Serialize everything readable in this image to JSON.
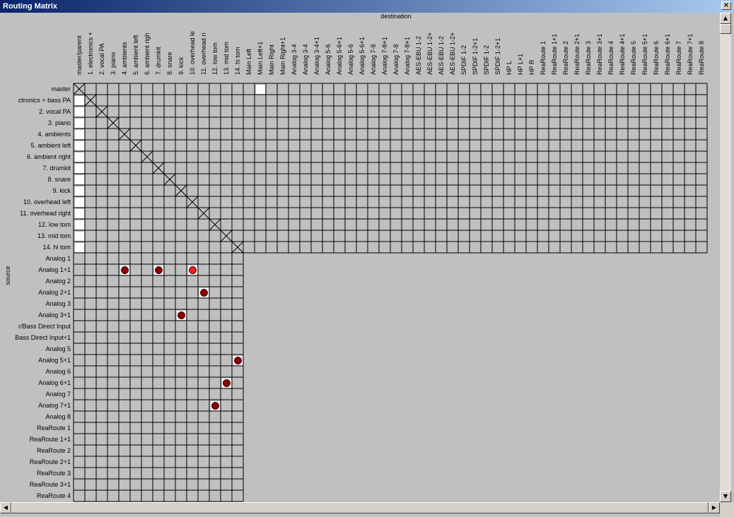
{
  "window": {
    "title": "Routing Matrix",
    "close_glyph": "×"
  },
  "axes": {
    "destination": "destination",
    "source": "source"
  },
  "columns": [
    "master/parent",
    "1. electronics +",
    "2. vocal PA",
    "3. piano",
    "4. ambients",
    "5. ambient left",
    "6. ambient righ",
    "7. drumkit",
    "8. snare",
    "9. kick",
    "10. overhead le",
    "11. overhead ri",
    "12. low tom",
    "13. mid tom",
    "14. hi tom",
    "Main Left",
    "Main Left+1",
    "Main Right",
    "Main Right+1",
    "Analog 3-4",
    "Analog 3-4",
    "Analog 3-4+1",
    "Analog 5-6",
    "Analog 5-6+1",
    "Analog 5-6",
    "Analog 5-6+1",
    "Analog 7-8",
    "Analog 7-8+1",
    "Analog 7-8",
    "Analog 7-8+1",
    "AES-EBU 1-2",
    "AES-EBU 1-2+",
    "AES-EBU 1-2",
    "AES-EBU 1-2+",
    "SPDIF 1-2",
    "SPDIF 1-2+1",
    "SPDIF 1-2",
    "SPDIF 1-2+1",
    "HP L",
    "HP L+1",
    "HP R",
    "ReaRoute 1",
    "ReaRoute 1+1",
    "ReaRoute 2",
    "ReaRoute 2+1",
    "ReaRoute 3",
    "ReaRoute 3+1",
    "ReaRoute 4",
    "ReaRoute 4+1",
    "ReaRoute 5",
    "ReaRoute 5+1",
    "ReaRoute 6",
    "ReaRoute 6+1",
    "ReaRoute 7",
    "ReaRoute 7+1",
    "ReaRoute 8"
  ],
  "rows": [
    "master",
    "ctronics + bass PA",
    "2. vocal PA",
    "3. piano",
    "4. ambients",
    "5. ambient left",
    "6. ambient right",
    "7. drumkit",
    "8. snare",
    "9. kick",
    "10. overhead left",
    "11. overhead right",
    "12. low tom",
    "13. mid tom",
    "14. hi tom",
    "Analog 1",
    "Analog 1+1",
    "Analog 2",
    "Analog 2+1",
    "Analog 3",
    "Analog 3+1",
    "r/Bass Direct Input",
    "Bass Direct Input+1",
    "Analog 5",
    "Analog 5+1",
    "Analog 6",
    "Analog 6+1",
    "Analog 7",
    "Analog 7+1",
    "Analog 8",
    "ReaRoute 1",
    "ReaRoute 1+1",
    "ReaRoute 2",
    "ReaRoute 2+1",
    "ReaRoute 3",
    "ReaRoute 3+1",
    "ReaRoute 4"
  ],
  "track_count": 15,
  "track_row_count": 15,
  "master_row_outputs": [
    1
  ],
  "connections": [
    {
      "source": "Analog 1+1",
      "destination": "4. ambients",
      "active": false
    },
    {
      "source": "Analog 1+1",
      "destination": "7. drumkit",
      "active": false
    },
    {
      "source": "Analog 1+1",
      "destination": "10. overhead le",
      "active": true
    },
    {
      "source": "Analog 2+1",
      "destination": "11. overhead ri",
      "active": false
    },
    {
      "source": "Analog 3+1",
      "destination": "9. kick",
      "active": false
    },
    {
      "source": "Analog 5+1",
      "destination": "14. hi tom",
      "active": false
    },
    {
      "source": "Analog 6+1",
      "destination": "13. mid tom",
      "active": false
    },
    {
      "source": "Analog 7+1",
      "destination": "12. low tom",
      "active": false
    }
  ],
  "colors": {
    "background": "#c0c0c0",
    "cell_line": "#000000",
    "connection_dot": "#8b0000",
    "connection_dot_active": "#ff1a1a",
    "cell_white": "#ffffff"
  },
  "scroll_icons": {
    "up": "▲",
    "down": "▼",
    "left": "◀",
    "right": "▶"
  }
}
